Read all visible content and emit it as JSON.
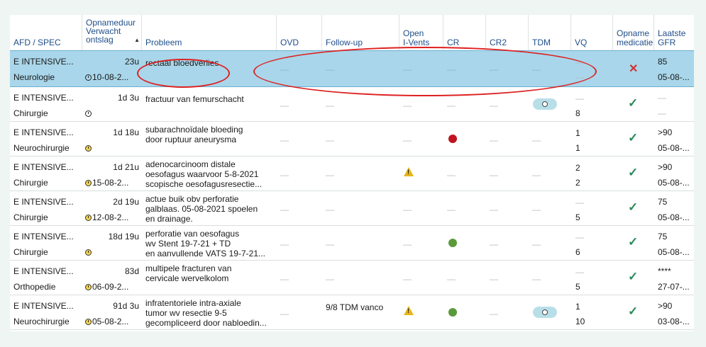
{
  "headers": {
    "afd": "AFD / SPEC",
    "opname_l1": "Opnameduur",
    "opname_l2": "Verwacht",
    "opname_l3": "ontslag",
    "probleem": "Probleem",
    "ovd": "OVD",
    "followup": "Follow-up",
    "open_l1": "Open",
    "open_l2": "I-Vents",
    "cr": "CR",
    "cr2": "CR2",
    "tdm": "TDM",
    "vq": "VQ",
    "med_l1": "Opname",
    "med_l2": "medicatie",
    "gfr_l1": "Laatste",
    "gfr_l2": "GFR"
  },
  "rows": [
    {
      "afd": "E INTENSIVE...",
      "spec": "Neurologie",
      "duur": "23u",
      "ontslag": "10-08-2...",
      "clock": "white",
      "p1": "rectaal bloedverlies",
      "p2": "",
      "p3": "",
      "followup": "",
      "ivent": false,
      "cr": "",
      "tdm": false,
      "vq1": "—",
      "vq2": "—",
      "med": "x",
      "gfr1": "85",
      "gfr2": "05-08-..."
    },
    {
      "afd": "E INTENSIVE...",
      "spec": "Chirurgie",
      "duur": "1d 3u",
      "ontslag": "",
      "clock": "white",
      "p1": "fractuur van femurschacht",
      "p2": "",
      "p3": "",
      "followup": "",
      "ivent": false,
      "cr": "",
      "tdm": true,
      "vq1": "—",
      "vq2": "8",
      "med": "check",
      "gfr1": "—",
      "gfr2": "—"
    },
    {
      "afd": "E INTENSIVE...",
      "spec": "Neurochirurgie",
      "duur": "1d 18u",
      "ontslag": "",
      "clock": "yellow",
      "p1": "subarachnoïdale bloeding",
      "p2": "door ruptuur aneurysma",
      "p3": "",
      "followup": "",
      "ivent": false,
      "cr": "#c0141e",
      "tdm": false,
      "vq1": "1",
      "vq2": "1",
      "med": "check",
      "gfr1": ">90",
      "gfr2": "05-08-..."
    },
    {
      "afd": "E INTENSIVE...",
      "spec": "Chirurgie",
      "duur": "1d 21u",
      "ontslag": "15-08-2...",
      "clock": "yellow",
      "p1": "adenocarcinoom distale",
      "p2": "oesofagus waarvoor 5-8-2021",
      "p3": "scopische oesofagusresectie...",
      "followup": "",
      "ivent": true,
      "cr": "",
      "tdm": false,
      "vq1": "2",
      "vq2": "2",
      "med": "check",
      "gfr1": ">90",
      "gfr2": "05-08-..."
    },
    {
      "afd": "E INTENSIVE...",
      "spec": "Chirurgie",
      "duur": "2d 19u",
      "ontslag": "12-08-2...",
      "clock": "yellow",
      "p1": "actue buik obv perforatie",
      "p2": "galblaas. 05-08-2021 spoelen",
      "p3": "en drainage.",
      "followup": "",
      "ivent": false,
      "cr": "",
      "tdm": false,
      "vq1": "—",
      "vq2": "5",
      "med": "check",
      "gfr1": "75",
      "gfr2": "05-08-..."
    },
    {
      "afd": "E INTENSIVE...",
      "spec": "Chirurgie",
      "duur": "18d 19u",
      "ontslag": "",
      "clock": "yellow",
      "p1": "perforatie van oesofagus",
      "p2": "wv Stent 19-7-21 + TD",
      "p3": "en aanvullende VATS 19-7-21...",
      "followup": "",
      "ivent": false,
      "cr": "#5a9a3a",
      "tdm": false,
      "vq1": "—",
      "vq2": "6",
      "med": "check",
      "gfr1": "75",
      "gfr2": "05-08-..."
    },
    {
      "afd": "E INTENSIVE...",
      "spec": "Orthopedie",
      "duur": "83d",
      "ontslag": "06-09-2...",
      "clock": "yellow",
      "p1": "multipele fracturen van",
      "p2": "cervicale wervelkolom",
      "p3": "",
      "followup": "",
      "ivent": false,
      "cr": "",
      "tdm": false,
      "vq1": "—",
      "vq2": "5",
      "med": "check",
      "gfr1": "****",
      "gfr2": "27-07-..."
    },
    {
      "afd": "E INTENSIVE...",
      "spec": "Neurochirurgie",
      "duur": "91d 3u",
      "ontslag": "05-08-2...",
      "clock": "yellow",
      "p1": "infratentoriele intra-axiale",
      "p2": "tumor wv resectie 9-5",
      "p3": "gecompliceerd door nabloedin...",
      "followup": "9/8 TDM vanco",
      "ivent": true,
      "cr": "#5a9a3a",
      "tdm": true,
      "vq1": "1",
      "vq2": "10",
      "med": "check",
      "gfr1": ">90",
      "gfr2": "03-08-..."
    }
  ],
  "dash": "—"
}
